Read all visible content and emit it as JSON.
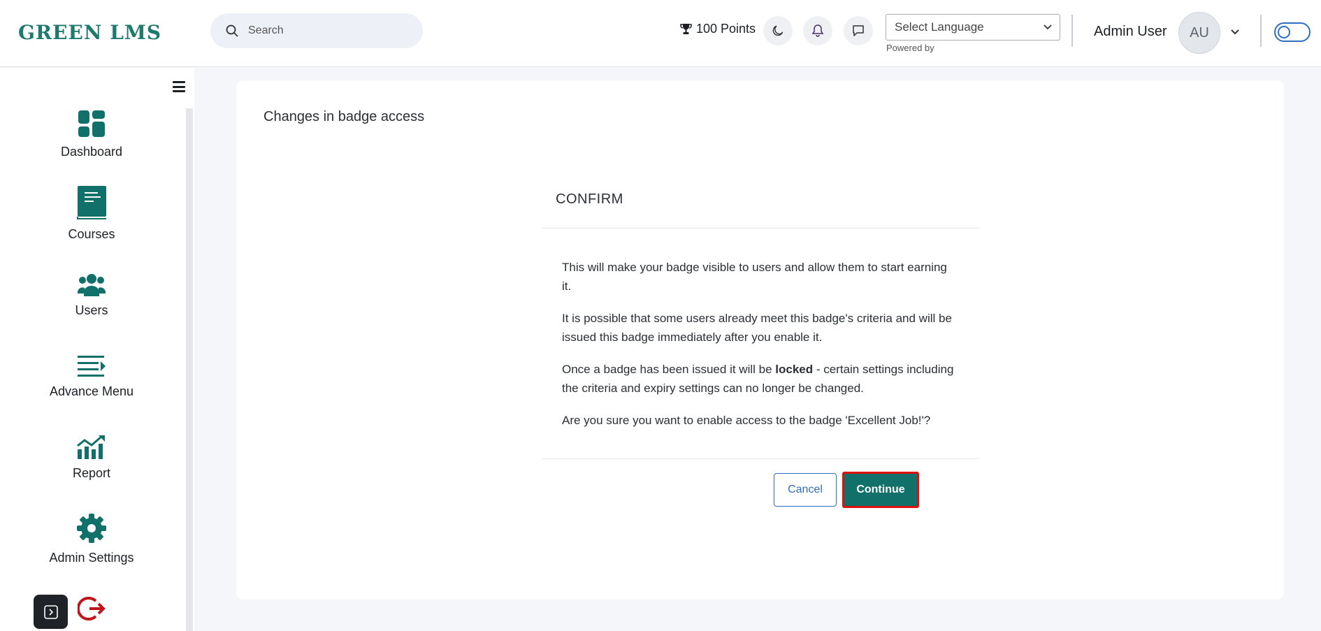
{
  "header": {
    "logo_text": "GREEN LMS",
    "search_placeholder": "Search",
    "points": "100 Points",
    "language_select": "Select Language",
    "powered_by": "Powered by",
    "user_name": "Admin User",
    "avatar_initials": "AU"
  },
  "sidebar": {
    "items": [
      {
        "label": "Dashboard",
        "icon": "dashboard-icon"
      },
      {
        "label": "Courses",
        "icon": "book-icon"
      },
      {
        "label": "Users",
        "icon": "users-icon"
      },
      {
        "label": "Advance Menu",
        "icon": "menu-list-icon"
      },
      {
        "label": "Report",
        "icon": "chart-growth-icon"
      },
      {
        "label": "Admin Settings",
        "icon": "gear-icon"
      }
    ]
  },
  "main": {
    "card_title": "Changes in badge access",
    "dialog": {
      "title": "CONFIRM",
      "paragraph1": "This will make your badge visible to users and allow them to start earning it.",
      "paragraph2": "It is possible that some users already meet this badge's criteria and will be issued this badge immediately after you enable it.",
      "paragraph3_before": "Once a badge has been issued it will be ",
      "paragraph3_bold": "locked",
      "paragraph3_after": " - certain settings including the criteria and expiry settings can no longer be changed.",
      "paragraph4": "Are you sure you want to enable access to the badge 'Excellent Job!'?",
      "cancel_label": "Cancel",
      "continue_label": "Continue"
    }
  },
  "colors": {
    "brand_teal": "#12706a",
    "link_blue": "#2e6fc4",
    "highlight_red": "#e01010",
    "logout_red": "#c0141b"
  }
}
